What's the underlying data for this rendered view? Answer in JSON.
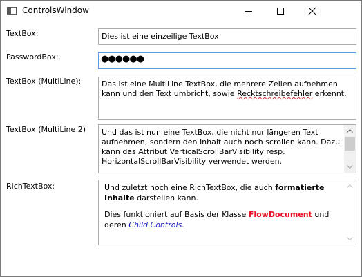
{
  "window": {
    "title": "ControlsWindow"
  },
  "fields": {
    "textbox": {
      "label": "TextBox:",
      "value": "Dies ist eine einzeilige TextBox"
    },
    "passwordbox": {
      "label": "PasswordBox:",
      "masked_value": "●●●●●●"
    },
    "multiline": {
      "label": "TextBox (MultiLine):",
      "text_before": "Das ist eine MultiLine TextBox, die mehrere Zeilen aufnehmen kann und den Text umbricht, sowie ",
      "misspelled": "Recktschreibefehler",
      "text_after": " erkennt."
    },
    "multiline2": {
      "label": "TextBox (MultiLine 2)",
      "text": "Und das ist nun eine TextBox, die nicht nur längeren Text aufnehmen, sondern den Inhalt auch noch scrollen kann. Dazu kann das Attribut VerticalScrollBarVisibility resp. HorizontalScrollBarVisibility verwendet werden."
    },
    "richtextbox": {
      "label": "RichTextBox:",
      "p1_start": "Und zuletzt noch eine RichTextBox, die auch ",
      "p1_bold": "formatierte Inhalte",
      "p1_end": " darstellen kann.",
      "p2_start": "Dies funktioniert auf Basis der Klasse ",
      "p2_red": "FlowDocument",
      "p2_mid": " und deren ",
      "p2_link": "Child Controls",
      "p2_end": "."
    }
  },
  "colors": {
    "focus_border": "#569de5",
    "accent_red": "#e81123",
    "link_blue": "#2020c0"
  },
  "icons": {
    "minimize": "minimize-icon",
    "maximize": "maximize-icon",
    "close": "close-icon",
    "scroll_up": "chevron-up-icon",
    "scroll_down": "chevron-down-icon"
  }
}
